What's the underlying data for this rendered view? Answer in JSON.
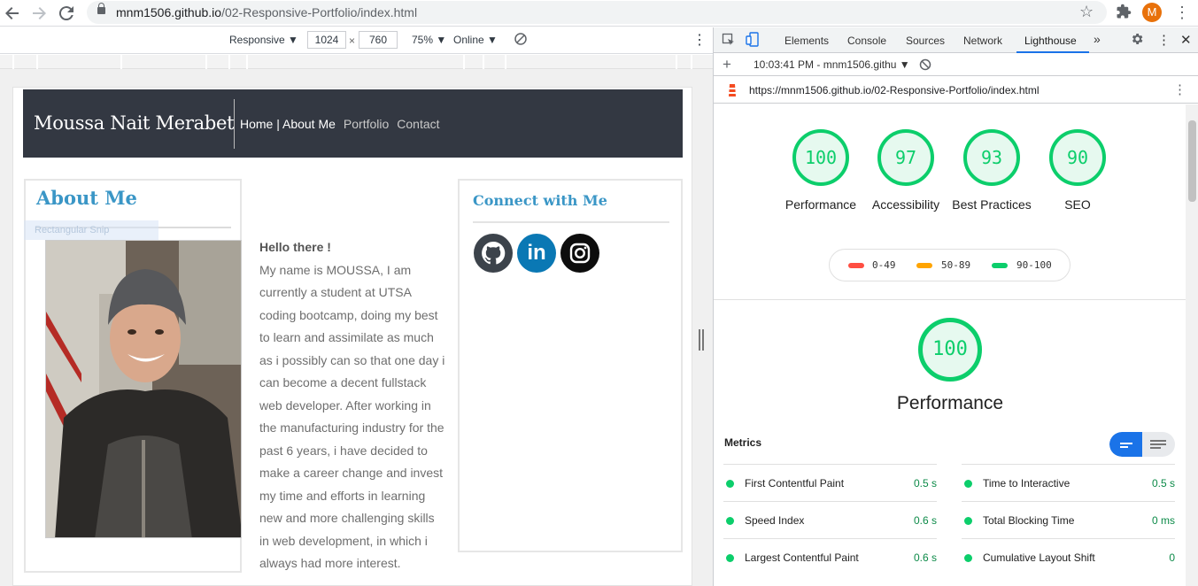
{
  "browser": {
    "url_host": "mnm1506.github.io",
    "url_path": "/02-Responsive-Portfolio/index.html",
    "profile_initial": "M"
  },
  "device_toolbar": {
    "device": "Responsive",
    "width": "1024",
    "height": "760",
    "zoom": "75%",
    "network": "Online"
  },
  "site": {
    "name": "Moussa Nait Merabet",
    "nav": {
      "active": "Home | About Me",
      "links": [
        "Portfolio",
        "Contact"
      ]
    },
    "about": {
      "title": "About Me",
      "greeting": "Hello there !",
      "bio": "My name is MOUSSA, I am currently a student at UTSA coding bootcamp, doing my best to learn and assimilate as much as i possibly can so that one day i can become a decent fullstack web developer. After working in the manufacturing industry for the past 6 years, i have decided to make a career change and invest my time and efforts in learning new and more challenging skills in web development, in which i always had more interest."
    },
    "overlay_text": "Rectangular Snip",
    "connect": {
      "title": "Connect with Me",
      "icons": [
        "github-icon",
        "linkedin-icon",
        "instagram-icon"
      ],
      "linkedin_label": "in"
    }
  },
  "devtools": {
    "tabs": [
      "Elements",
      "Console",
      "Sources",
      "Network",
      "Lighthouse"
    ],
    "active_tab": "Lighthouse",
    "report_time": "10:03:41 PM - mnm1506.githu",
    "report_url": "https://mnm1506.github.io/02-Responsive-Portfolio/index.html",
    "scores": [
      {
        "label": "Performance",
        "value": "100"
      },
      {
        "label": "Accessibility",
        "value": "97"
      },
      {
        "label": "Best Practices",
        "value": "93"
      },
      {
        "label": "SEO",
        "value": "90"
      }
    ],
    "legend": [
      "0-49",
      "50-89",
      "90-100"
    ],
    "legend_colors": [
      "#ff4e42",
      "#ffa400",
      "#0cce6b"
    ],
    "performance_score": "100",
    "performance_label": "Performance",
    "metrics_title": "Metrics",
    "metrics": [
      {
        "name": "First Contentful Paint",
        "value": "0.5 s"
      },
      {
        "name": "Time to Interactive",
        "value": "0.5 s"
      },
      {
        "name": "Speed Index",
        "value": "0.6 s"
      },
      {
        "name": "Total Blocking Time",
        "value": "0 ms"
      },
      {
        "name": "Largest Contentful Paint",
        "value": "0.6 s"
      },
      {
        "name": "Cumulative Layout Shift",
        "value": "0"
      }
    ]
  }
}
